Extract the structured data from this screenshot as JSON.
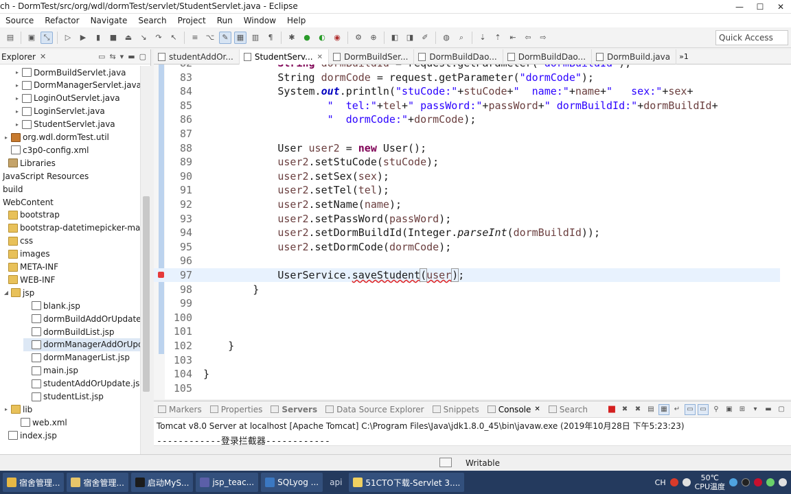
{
  "window": {
    "title": "ch - DormTest/src/org/wdl/dormTest/servlet/StudentServlet.java - Eclipse",
    "minimize": "—",
    "maximize": "☐",
    "close": "✕"
  },
  "menu": [
    "Source",
    "Refactor",
    "Navigate",
    "Search",
    "Project",
    "Run",
    "Window",
    "Help"
  ],
  "toolbar": {
    "quick_access": "Quick Access"
  },
  "explorer": {
    "title": "Explorer",
    "items": [
      {
        "label": "DormBuildServlet.java",
        "icon": "java-file-icon",
        "arrow": "▸",
        "indent": 20
      },
      {
        "label": "DormManagerServlet.java",
        "icon": "java-file-icon",
        "arrow": "▸",
        "indent": 20
      },
      {
        "label": "LoginOutServlet.java",
        "icon": "java-file-icon",
        "arrow": "▸",
        "indent": 20
      },
      {
        "label": "LoginServlet.java",
        "icon": "java-file-icon",
        "arrow": "▸",
        "indent": 20
      },
      {
        "label": "StudentServlet.java",
        "icon": "java-file-icon",
        "arrow": "▸",
        "indent": 20
      },
      {
        "label": "org.wdl.dormTest.util",
        "icon": "package-icon",
        "arrow": "▸",
        "indent": 4
      },
      {
        "label": "c3p0-config.xml",
        "icon": "xml-file-icon",
        "arrow": "",
        "indent": 4
      },
      {
        "label": "Libraries",
        "icon": "library-icon",
        "arrow": "",
        "indent": 0
      },
      {
        "label": "JavaScript Resources",
        "icon": "",
        "arrow": "",
        "indent": -6
      },
      {
        "label": "build",
        "icon": "",
        "arrow": "",
        "indent": -6
      },
      {
        "label": "WebContent",
        "icon": "",
        "arrow": "",
        "indent": -6
      },
      {
        "label": "bootstrap",
        "icon": "folder-icon",
        "arrow": "",
        "indent": 0
      },
      {
        "label": "bootstrap-datetimepicker-master",
        "icon": "folder-icon",
        "arrow": "",
        "indent": 0
      },
      {
        "label": "css",
        "icon": "folder-icon",
        "arrow": "",
        "indent": 0
      },
      {
        "label": "images",
        "icon": "folder-icon",
        "arrow": "",
        "indent": 0
      },
      {
        "label": "META-INF",
        "icon": "folder-icon",
        "arrow": "",
        "indent": 0
      },
      {
        "label": "WEB-INF",
        "icon": "folder-icon",
        "arrow": "",
        "indent": 0
      },
      {
        "label": "jsp",
        "icon": "folder-icon",
        "arrow": "◢",
        "indent": 4
      },
      {
        "label": "blank.jsp",
        "icon": "jsp-file-icon",
        "arrow": "",
        "indent": 34
      },
      {
        "label": "dormBuildAddOrUpdate.jsp",
        "icon": "jsp-file-icon",
        "arrow": "",
        "indent": 34
      },
      {
        "label": "dormBuildList.jsp",
        "icon": "jsp-file-icon",
        "arrow": "",
        "indent": 34
      },
      {
        "label": "dormManagerAddOrUpdate",
        "icon": "jsp-file-icon",
        "arrow": "",
        "indent": 34,
        "selected": true
      },
      {
        "label": "dormManagerList.jsp",
        "icon": "jsp-file-icon",
        "arrow": "",
        "indent": 34
      },
      {
        "label": "main.jsp",
        "icon": "jsp-file-icon",
        "arrow": "",
        "indent": 34
      },
      {
        "label": "studentAddOrUpdate.jsp",
        "icon": "jsp-file-icon",
        "arrow": "",
        "indent": 34
      },
      {
        "label": "studentList.jsp",
        "icon": "jsp-file-icon",
        "arrow": "",
        "indent": 34
      },
      {
        "label": "lib",
        "icon": "folder-icon",
        "arrow": "▸",
        "indent": 4
      },
      {
        "label": "web.xml",
        "icon": "xml-file-icon",
        "arrow": "",
        "indent": 18
      },
      {
        "label": "index.jsp",
        "icon": "jsp-file-icon",
        "arrow": "",
        "indent": 0
      }
    ]
  },
  "editor_tabs": [
    {
      "label": "studentAddOr...",
      "active": false
    },
    {
      "label": "StudentServ...",
      "active": true
    },
    {
      "label": "DormBuildSer...",
      "active": false
    },
    {
      "label": "DormBuildDao...",
      "active": false
    },
    {
      "label": "DormBuildDao...",
      "active": false
    },
    {
      "label": "DormBuild.java",
      "active": false
    }
  ],
  "editor_tabs_overflow": "»1",
  "code_lines": [
    {
      "n": "82",
      "html": "            <span class=\"kw\">String</span> <span class=\"var\">dormBuildId</span> = request.getParameter(<span class=\"str\">\"dormBuildId\"</span>);"
    },
    {
      "n": "83",
      "html": "            String <span class=\"var\">dormCode</span> = request.getParameter(<span class=\"str\">\"dormCode\"</span>);"
    },
    {
      "n": "84",
      "html": "            System.<span class=\"fld\">out</span>.println(<span class=\"str\">\"stuCode:\"</span>+<span class=\"var\">stuCode</span>+<span class=\"str\">\"  name:\"</span>+<span class=\"var\">name</span>+<span class=\"str\">\"   sex:\"</span>+<span class=\"var\">sex</span>+"
    },
    {
      "n": "85",
      "html": "                    <span class=\"str\">\"  tel:\"</span>+<span class=\"var\">tel</span>+<span class=\"str\">\" passWord:\"</span>+<span class=\"var\">passWord</span>+<span class=\"str\">\" dormBuildId:\"</span>+<span class=\"var\">dormBuildId</span>+"
    },
    {
      "n": "86",
      "html": "                    <span class=\"str\">\"  dormCode:\"</span>+<span class=\"var\">dormCode</span>);"
    },
    {
      "n": "87",
      "html": ""
    },
    {
      "n": "88",
      "html": "            User <span class=\"var\">user2</span> = <span class=\"kw\">new</span> User();"
    },
    {
      "n": "89",
      "html": "            <span class=\"var\">user2</span>.setStuCode(<span class=\"var\">stuCode</span>);"
    },
    {
      "n": "90",
      "html": "            <span class=\"var\">user2</span>.setSex(<span class=\"var\">sex</span>);"
    },
    {
      "n": "91",
      "html": "            <span class=\"var\">user2</span>.setTel(<span class=\"var\">tel</span>);"
    },
    {
      "n": "92",
      "html": "            <span class=\"var\">user2</span>.setName(<span class=\"var\">name</span>);"
    },
    {
      "n": "93",
      "html": "            <span class=\"var\">user2</span>.setPassWord(<span class=\"var\">passWord</span>);"
    },
    {
      "n": "94",
      "html": "            <span class=\"var\">user2</span>.setDormBuildId(Integer.<span class=\"static-m\">parseInt</span>(<span class=\"var\">dormBuildId</span>));"
    },
    {
      "n": "95",
      "html": "            <span class=\"var\">user2</span>.setDormCode(<span class=\"var\">dormCode</span>);"
    },
    {
      "n": "96",
      "html": ""
    },
    {
      "n": "97",
      "html": "            UserService.<span class=\"err\">saveStudent</span><span class=\"bracket\">(</span><span class=\"err var\">user</span><span class=\"cursor\"></span><span class=\"bracket\">)</span>;",
      "current": true,
      "error": true
    },
    {
      "n": "98",
      "html": "        }"
    },
    {
      "n": "99",
      "html": ""
    },
    {
      "n": "100",
      "html": ""
    },
    {
      "n": "101",
      "html": ""
    },
    {
      "n": "102",
      "html": "    }"
    },
    {
      "n": "103",
      "html": ""
    },
    {
      "n": "104",
      "html": "}"
    },
    {
      "n": "105",
      "html": ""
    }
  ],
  "bottom_tabs": [
    {
      "label": "Markers",
      "active": false
    },
    {
      "label": "Properties",
      "active": false
    },
    {
      "label": "Servers",
      "active": false,
      "bold": true
    },
    {
      "label": "Data Source Explorer",
      "active": false
    },
    {
      "label": "Snippets",
      "active": false
    },
    {
      "label": "Console",
      "active": true
    },
    {
      "label": "Search",
      "active": false
    }
  ],
  "console": {
    "title": "Tomcat v8.0 Server at localhost [Apache Tomcat] C:\\Program Files\\Java\\jdk1.8.0_45\\bin\\javaw.exe (2019年10月28日 下午5:23:23)",
    "output": "------------登录拦截器------------"
  },
  "status": {
    "writable": "Writable"
  },
  "taskbar": {
    "tasks": [
      {
        "label": "宿舍管理...",
        "color": "#e7b845"
      },
      {
        "label": "宿舍管理...",
        "color": "#e7c56a"
      },
      {
        "label": "启动MyS...",
        "color": "#1c1c1c"
      },
      {
        "label": "jsp_teac...",
        "color": "#5b5fa8"
      },
      {
        "label": "SQLyog ...",
        "color": "#3b78c2"
      },
      {
        "label": "api",
        "color": "",
        "plain": true
      },
      {
        "label": "51CTO下载-Servlet 3....",
        "color": "#f0d060"
      }
    ],
    "tray": {
      "ime": "CH",
      "temp": "50℃",
      "cpu_label": "CPU温度"
    }
  }
}
